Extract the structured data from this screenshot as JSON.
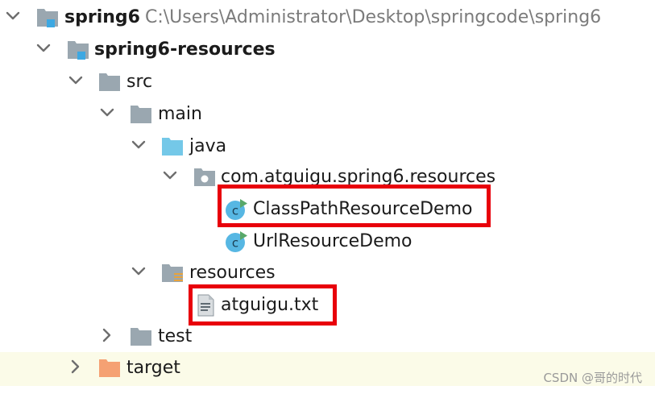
{
  "tree": {
    "root": {
      "label": "spring6",
      "path": "C:\\Users\\Administrator\\Desktop\\springcode\\spring6"
    },
    "module": {
      "label": "spring6-resources"
    },
    "src": {
      "label": "src"
    },
    "main": {
      "label": "main"
    },
    "java": {
      "label": "java"
    },
    "package": {
      "label": "com.atguigu.spring6.resources"
    },
    "class_classpath": {
      "label": "ClassPathResourceDemo"
    },
    "class_url": {
      "label": "UrlResourceDemo"
    },
    "resources": {
      "label": "resources"
    },
    "file_txt": {
      "label": "atguigu.txt"
    },
    "test": {
      "label": "test"
    },
    "target": {
      "label": "target"
    }
  },
  "watermark": "CSDN @哥的时代",
  "colors": {
    "module_folder": "#9aa7b0",
    "module_badge": "#3da8e2",
    "source_folder": "#74c8e8",
    "excluded_folder": "#f5a173",
    "class_icon": "#57b7e3",
    "run_arrow": "#59a869",
    "highlight_box": "#e8000b",
    "selected_row": "#fbfbe8"
  },
  "icons": {
    "expanded": "chevron-down-icon",
    "collapsed": "chevron-right-icon",
    "module": "module-folder-icon",
    "folder": "folder-icon",
    "source_root": "source-folder-icon",
    "package": "package-icon",
    "class": "java-class-icon",
    "resources_root": "resources-folder-icon",
    "text_file": "text-file-icon",
    "excluded": "excluded-folder-icon"
  }
}
